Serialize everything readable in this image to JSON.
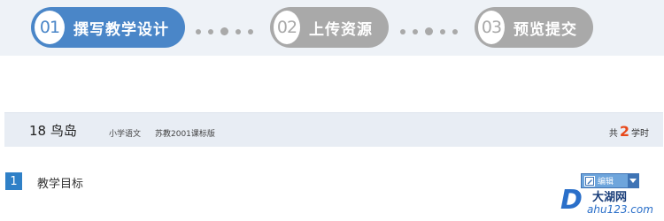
{
  "steps": [
    {
      "num": "01",
      "label": "撰写教学设计",
      "state": "active"
    },
    {
      "num": "02",
      "label": "上传资源",
      "state": "inactive"
    },
    {
      "num": "03",
      "label": "预览提交",
      "state": "inactive"
    }
  ],
  "lesson": {
    "title": "18 鸟岛",
    "subject": "小学语文",
    "edition": "苏教2001课标版",
    "hours_prefix": "共",
    "hours_value": "2",
    "hours_suffix": "学时"
  },
  "section": {
    "number": "1",
    "title": "教学目标",
    "edit_label": "编辑"
  },
  "watermark": {
    "letter": "D",
    "name": "大湖网",
    "domain": "ahu123.com"
  },
  "colors": {
    "active_step": "#4a86c8",
    "inactive_step": "#a9a9a9",
    "hours_accent": "#e8491b",
    "section_badge": "#2f80c7"
  }
}
